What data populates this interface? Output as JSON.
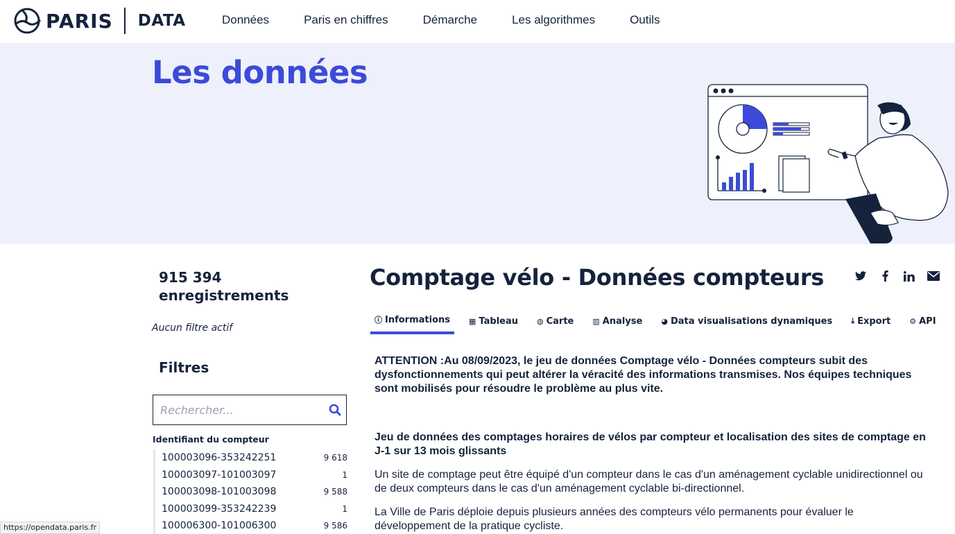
{
  "header": {
    "logo_paris": "PARIS",
    "logo_data": "DATA",
    "nav": [
      "Données",
      "Paris en chiffres",
      "Démarche",
      "Les algorithmes",
      "Outils"
    ]
  },
  "hero": {
    "title": "Les données"
  },
  "sidebar": {
    "count": "915 394 enregistrements",
    "no_filter": "Aucun filtre actif",
    "filters_title": "Filtres",
    "search_placeholder": "Rechercher...",
    "facet_title": "Identifiant du compteur",
    "facets": [
      {
        "value": "100003096-353242251",
        "count": "9 618"
      },
      {
        "value": "100003097-101003097",
        "count": "1"
      },
      {
        "value": "100003098-101003098",
        "count": "9 588"
      },
      {
        "value": "100003099-353242239",
        "count": "1"
      },
      {
        "value": "100006300-101006300",
        "count": "9 586"
      }
    ]
  },
  "main": {
    "title": "Comptage vélo - Données compteurs",
    "share_icons": [
      "twitter-icon",
      "facebook-icon",
      "linkedin-icon",
      "email-icon"
    ],
    "tabs": [
      {
        "label": "Informations",
        "icon": "ⓘ",
        "active": true
      },
      {
        "label": "Tableau",
        "icon": "▦",
        "active": false
      },
      {
        "label": "Carte",
        "icon": "◍",
        "active": false
      },
      {
        "label": "Analyse",
        "icon": "▥",
        "active": false
      },
      {
        "label": "Data visualisations dynamiques",
        "icon": "◕",
        "active": false
      },
      {
        "label": "Export",
        "icon": "⤓",
        "active": false
      },
      {
        "label": "API",
        "icon": "⚙",
        "active": false
      }
    ],
    "warning": "ATTENTION :Au 08/09/2023, le jeu de données Comptage vélo - Données compteurs subit des dysfonctionnements qui peut altérer la véracité des informations transmises. Nos équipes techniques sont mobilisés pour résoudre le problème au plus vite.",
    "lead": "Jeu de données des comptages horaires de vélos par compteur et localisation des sites de comptage en J-1 sur 13 mois glissants",
    "paragraphs": [
      "Un site de comptage peut être équipé d'un compteur dans le cas d'un aménagement cyclable unidirectionnel ou de deux compteurs dans le cas d'un aménagement cyclable bi-directionnel.",
      "La Ville de Paris déploie depuis plusieurs années des compteurs vélo permanents pour évaluer le développement de la pratique cycliste."
    ]
  },
  "statusbar": {
    "url": "https://opendata.paris.fr"
  },
  "colors": {
    "accent": "#3b4bd8",
    "navy": "#15223c",
    "hero_bg": "#eef0fb"
  }
}
